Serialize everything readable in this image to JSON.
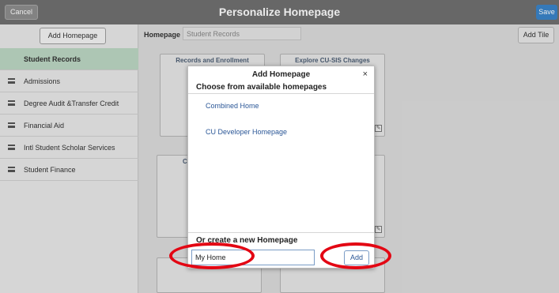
{
  "header": {
    "title": "Personalize Homepage",
    "cancel_label": "Cancel",
    "save_label": "Save"
  },
  "sidebar": {
    "add_homepage_label": "Add Homepage",
    "items": [
      {
        "label": "Student Records",
        "active": true
      },
      {
        "label": "Admissions"
      },
      {
        "label": "Degree Audit &Transfer Credit"
      },
      {
        "label": "Financial Aid"
      },
      {
        "label": "Intl Student Scholar Services"
      },
      {
        "label": "Student Finance"
      }
    ]
  },
  "main": {
    "homepage_label": "Homepage",
    "homepage_value": "Student Records",
    "add_tile_label": "Add Tile",
    "tiles": [
      {
        "title": "Records and Enrollment"
      },
      {
        "title": "Explore CU-SIS Changes"
      },
      {
        "title": "Co"
      },
      {
        "title": ""
      },
      {
        "title": ""
      },
      {
        "title": ""
      }
    ]
  },
  "modal": {
    "title": "Add Homepage",
    "close_label": "×",
    "subtitle": "Choose from available homepages",
    "options": [
      {
        "label": "Combined Home"
      },
      {
        "label": "CU Developer Homepage"
      }
    ],
    "create_label": "Or create a new Homepage",
    "new_homepage_value": "My Home",
    "add_label": "Add"
  },
  "colors": {
    "header_bg": "#707070",
    "save_blue": "#3a84c9",
    "active_item": "#bcd7c4",
    "link_blue": "#2b5797",
    "annotation_red": "#e30613"
  },
  "icons": [
    "hamburger-icon",
    "close-icon",
    "edit-icon"
  ]
}
